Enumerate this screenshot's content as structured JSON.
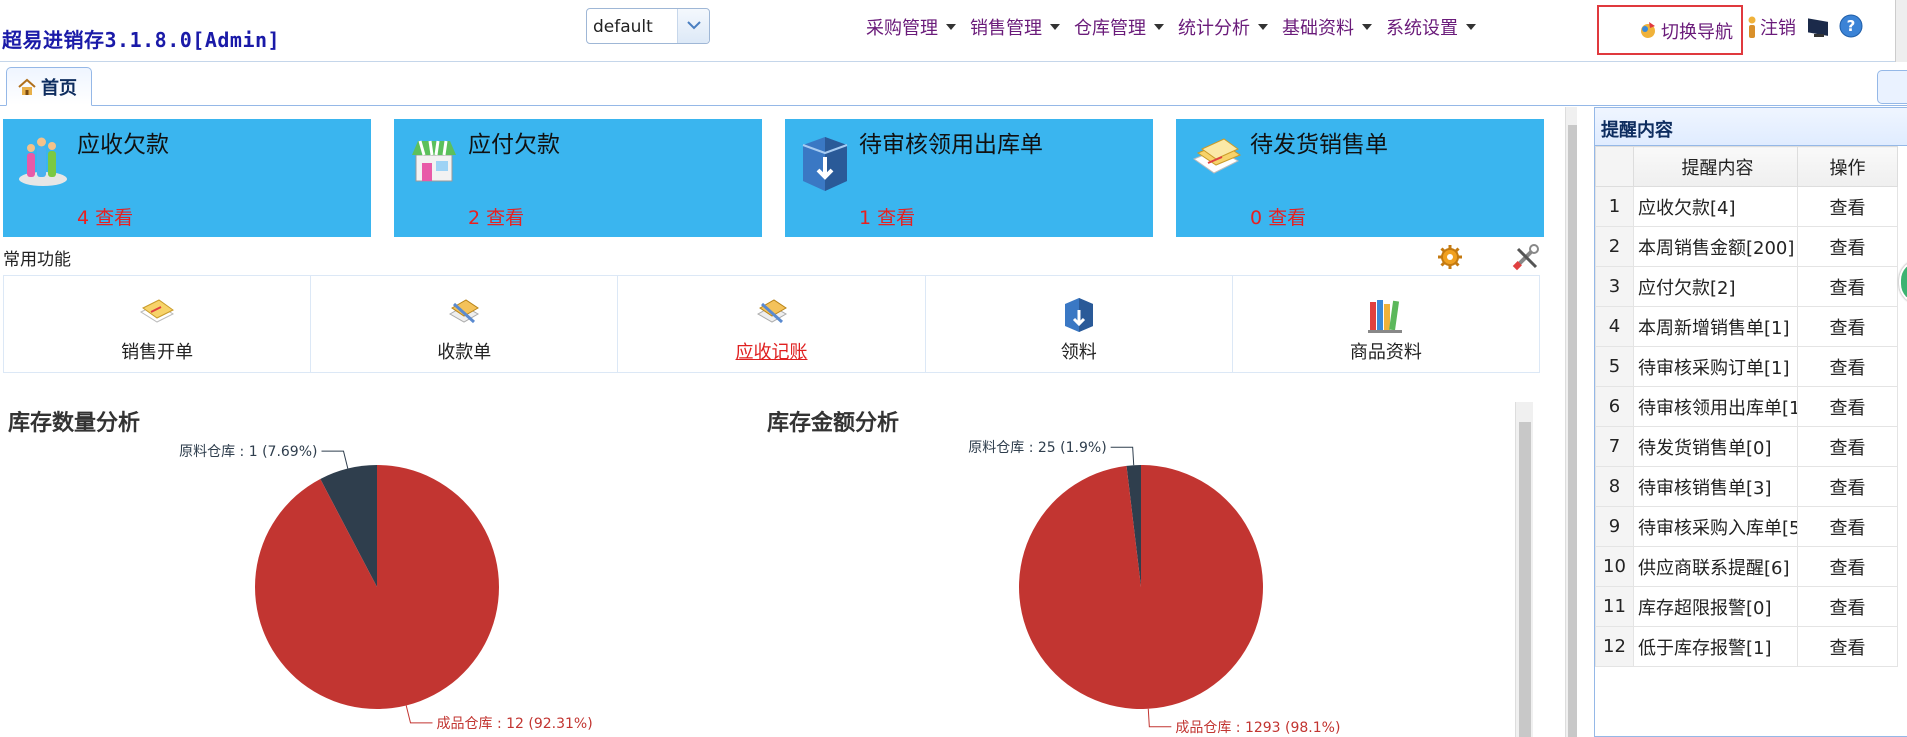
{
  "header": {
    "app_title": "超易进销存3.1.8.0[Admin]",
    "theme_value": "default",
    "nav": [
      {
        "label": "采购管理"
      },
      {
        "label": "销售管理"
      },
      {
        "label": "仓库管理"
      },
      {
        "label": "统计分析"
      },
      {
        "label": "基础资料"
      },
      {
        "label": "系统设置"
      }
    ],
    "switch_nav_label": "切换导航",
    "logout_label": "注销"
  },
  "tabs": {
    "home_label": "首页"
  },
  "kpis": [
    {
      "title": "应收欠款",
      "count": "4 查看",
      "icon": "people-icon"
    },
    {
      "title": "应付欠款",
      "count": "2 查看",
      "icon": "store-icon"
    },
    {
      "title": "待审核领用出库单",
      "count": "1 查看",
      "icon": "box-download-icon"
    },
    {
      "title": "待发货销售单",
      "count": "0 查看",
      "icon": "documents-icon"
    }
  ],
  "common": {
    "label": "常用功能",
    "items": [
      {
        "label": "销售开单",
        "icon": "sales-order-icon"
      },
      {
        "label": "收款单",
        "icon": "receipt-icon"
      },
      {
        "label": "应收记账",
        "icon": "ledger-icon"
      },
      {
        "label": "领料",
        "icon": "material-icon"
      },
      {
        "label": "商品资料",
        "icon": "books-icon"
      }
    ]
  },
  "chart_data": [
    {
      "type": "pie",
      "title": "库存数量分析",
      "slices": [
        {
          "label": "原料仓库 : 1 (7.69%)",
          "name": "原料仓库",
          "value": 1,
          "percent": 7.69,
          "color": "#2f3e4d"
        },
        {
          "label": "成品仓库 : 12 (92.31%)",
          "name": "成品仓库",
          "value": 12,
          "percent": 92.31,
          "color": "#c23531"
        }
      ]
    },
    {
      "type": "pie",
      "title": "库存金额分析",
      "slices": [
        {
          "label": "原料仓库 : 25 (1.9%)",
          "name": "原料仓库",
          "value": 25,
          "percent": 1.9,
          "color": "#2f3e4d"
        },
        {
          "label": "成品仓库 : 1293 (98.1%)",
          "name": "成品仓库",
          "value": 1293,
          "percent": 98.1,
          "color": "#c23531"
        }
      ]
    }
  ],
  "reminder": {
    "title": "提醒内容",
    "col_content": "提醒内容",
    "col_op": "操作",
    "rows": [
      {
        "no": "1",
        "content": "应收欠款[4]",
        "op": "查看"
      },
      {
        "no": "2",
        "content": "本周销售金额[200]",
        "op": "查看"
      },
      {
        "no": "3",
        "content": "应付欠款[2]",
        "op": "查看"
      },
      {
        "no": "4",
        "content": "本周新增销售单[1]",
        "op": "查看"
      },
      {
        "no": "5",
        "content": "待审核采购订单[1]",
        "op": "查看"
      },
      {
        "no": "6",
        "content": "待审核领用出库单[1",
        "op": "查看"
      },
      {
        "no": "7",
        "content": "待发货销售单[0]",
        "op": "查看"
      },
      {
        "no": "8",
        "content": "待审核销售单[3]",
        "op": "查看"
      },
      {
        "no": "9",
        "content": "待审核采购入库单[5",
        "op": "查看"
      },
      {
        "no": "10",
        "content": "供应商联系提醒[6]",
        "op": "查看"
      },
      {
        "no": "11",
        "content": "库存超限报警[0]",
        "op": "查看"
      },
      {
        "no": "12",
        "content": "低于库存报警[1]",
        "op": "查看"
      }
    ]
  }
}
